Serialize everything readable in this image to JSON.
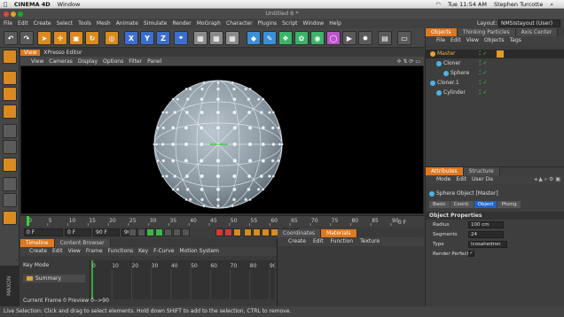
{
  "mac": {
    "apple": "",
    "app": "CINEMA 4D",
    "window": "Window",
    "time": "Tue 11:54 AM",
    "user": "Stephen Turcotte"
  },
  "title": "Untitled 6 *",
  "menu": [
    "File",
    "Edit",
    "Create",
    "Select",
    "Tools",
    "Mesh",
    "Animate",
    "Simulate",
    "Render",
    "MoGraph",
    "Character",
    "Plugins",
    "Script",
    "Window",
    "Help"
  ],
  "layout": {
    "label": "Layout:",
    "value": "NMSIstayout (User)"
  },
  "axis_buttons": [
    "X",
    "Y",
    "Z"
  ],
  "viewport": {
    "tab_view": "View",
    "tab_xpresso": "XPresso Editor",
    "menu": [
      "View",
      "Cameras",
      "Display",
      "Options",
      "Filter",
      "Panel"
    ]
  },
  "ruler": {
    "ticks": [
      "0",
      "5",
      "10",
      "15",
      "20",
      "25",
      "30",
      "35",
      "40",
      "45",
      "50",
      "55",
      "60",
      "65",
      "70",
      "75",
      "80",
      "85",
      "90"
    ],
    "end": "0 F"
  },
  "frames": {
    "start": "0 F",
    "field2": "0 F",
    "end": "90 F",
    "end2": "90 F"
  },
  "timeline": {
    "tabs": [
      "Timeline",
      "Content Browser"
    ],
    "menu": [
      "Create",
      "Edit",
      "View",
      "Frame",
      "Functions",
      "Key",
      "F-Curve",
      "Motion System"
    ],
    "mode": "Key Mode",
    "summary": "Summary",
    "ticks": [
      "0",
      "10",
      "20",
      "30",
      "40",
      "50",
      "60",
      "70",
      "80",
      "90"
    ],
    "current_frame_label": "Current Frame",
    "current_frame": "0",
    "preview_label": "Preview",
    "preview": "0-->90"
  },
  "coordinates": {
    "tabs": [
      "Coordinates",
      "Materials"
    ],
    "menu": [
      "Create",
      "Edit",
      "Function",
      "Texture"
    ]
  },
  "objects": {
    "tabs": [
      "Objects",
      "Thinking Particles",
      "Axis Center"
    ],
    "menu": [
      "File",
      "Edit",
      "View",
      "Objects",
      "Tags"
    ],
    "items": [
      {
        "name": "Master",
        "color": "#e8a13a",
        "indent": 0
      },
      {
        "name": "Cloner",
        "color": "#4ab4e6",
        "indent": 1
      },
      {
        "name": "Sphere",
        "color": "#4ab4e6",
        "indent": 2
      },
      {
        "name": "Cloner.1",
        "color": "#4ab4e6",
        "indent": 0
      },
      {
        "name": "Cylinder",
        "color": "#4ab4e6",
        "indent": 1
      }
    ]
  },
  "attributes": {
    "tabs": [
      "Attributes",
      "Structure"
    ],
    "menu": [
      "Mode",
      "Edit",
      "User Da"
    ],
    "object_title": "Sphere Object [Master]",
    "subtabs": [
      "Basic",
      "Coord.",
      "Object",
      "Phong"
    ],
    "section": "Object Properties",
    "radius_label": "Radius",
    "radius": "100 cm",
    "segments_label": "Segments",
    "segments": "24",
    "type_label": "Type",
    "type": "Icosahedron",
    "render_perfect_label": "Render Perfect",
    "render_perfect": "✓"
  },
  "brand": "MAXON CINEMA 4D",
  "status": "Live Selection: Click and drag to select elements. Hold down SHIFT to add to the selection, CTRL to remove."
}
